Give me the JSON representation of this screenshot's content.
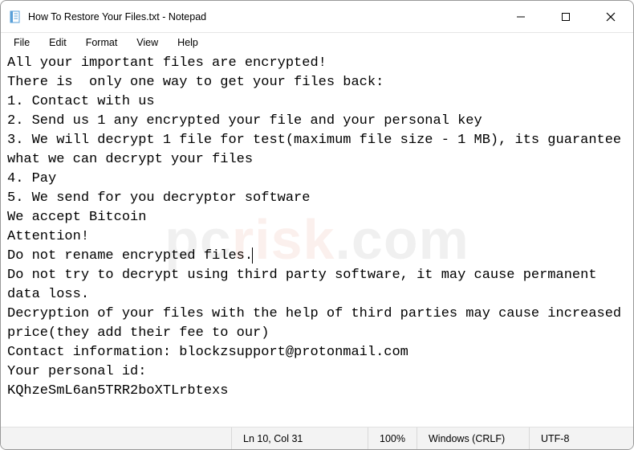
{
  "window": {
    "title": "How To Restore Your Files.txt - Notepad"
  },
  "menu": {
    "file": "File",
    "edit": "Edit",
    "format": "Format",
    "view": "View",
    "help": "Help"
  },
  "body": {
    "l1": "All your important files are encrypted!",
    "l2": "There is  only one way to get your files back:",
    "l3": "1. Contact with us",
    "l4": "2. Send us 1 any encrypted your file and your personal key",
    "l5": "3. We will decrypt 1 file for test(maximum file size - 1 MB), its guarantee what we can decrypt your files",
    "l6": "4. Pay",
    "l7": "5. We send for you decryptor software",
    "l8": "We accept Bitcoin",
    "l9": "Attention!",
    "l10a": "Do not rename encrypted files.",
    "l11": "Do not try to decrypt using third party software, it may cause permanent data loss.",
    "l12": "Decryption of your files with the help of third parties may cause increased  price(they add their fee to our)",
    "l13": "Contact information: blockzsupport@protonmail.com",
    "l14": "Your personal id:",
    "l15": "KQhzeSmL6an5TRR2boXTLrbtexs"
  },
  "status": {
    "position": "Ln 10, Col 31",
    "zoom": "100%",
    "line_ending": "Windows (CRLF)",
    "encoding": "UTF-8"
  },
  "watermark": {
    "a": "pc",
    "b": "risk",
    "c": ".com"
  }
}
